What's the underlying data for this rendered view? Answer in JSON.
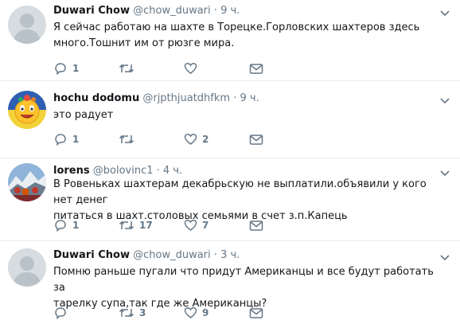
{
  "tweets": [
    {
      "name": "Duwari Chow",
      "handle": "@chow_duwari",
      "sep": "·",
      "time": "9 ч.",
      "text": "Я сейчас работаю на шахте в Торецке.Горловских шахтеров здесь\nмного.Тошнит им от рюзге мира.",
      "replies": "1",
      "retweets": "",
      "likes": "",
      "avatar": "default-avatar"
    },
    {
      "name": "hochu dodomu",
      "handle": "@rjpthjuatdhfkm",
      "sep": "·",
      "time": "9 ч.",
      "text": "это радует",
      "replies": "1",
      "retweets": "",
      "likes": "2",
      "avatar": "emoji-avatar"
    },
    {
      "name": "lorens",
      "handle": "@bolovinc1",
      "sep": "·",
      "time": "4 ч.",
      "text": "В Ровеньках шахтерам декабрьскую не выплатили.объявили у кого нет денег\nпитаться в шахт.столовых семьями в счет з.п.Капець",
      "replies": "1",
      "retweets": "17",
      "likes": "7",
      "avatar": "landscape-avatar"
    },
    {
      "name": "Duwari Chow",
      "handle": "@chow_duwari",
      "sep": "·",
      "time": "3 ч.",
      "text": "Помню раньше пугали что придут Американцы и все будут работать за\nтарелку супа,так где же Американцы?",
      "replies": "",
      "retweets": "3",
      "likes": "9",
      "avatar": "default-avatar"
    }
  ],
  "colors": {
    "text": "#14171a",
    "muted": "#657786",
    "border": "#e6ecf0"
  }
}
